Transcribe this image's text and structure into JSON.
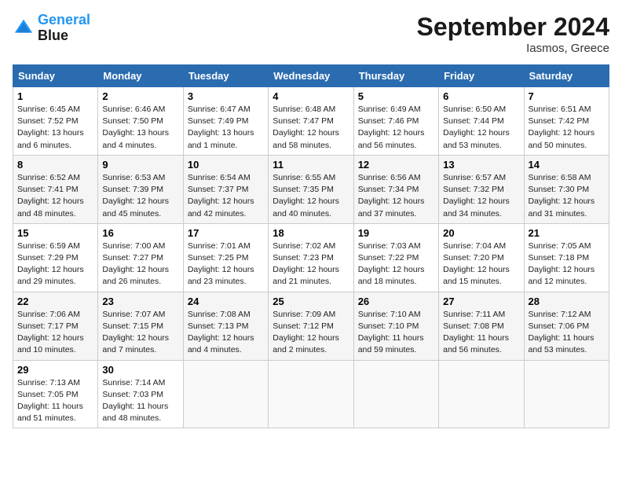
{
  "header": {
    "logo_line1": "General",
    "logo_line2": "Blue",
    "month": "September 2024",
    "location": "Iasmos, Greece"
  },
  "days_of_week": [
    "Sunday",
    "Monday",
    "Tuesday",
    "Wednesday",
    "Thursday",
    "Friday",
    "Saturday"
  ],
  "weeks": [
    [
      {
        "day": "1",
        "sunrise": "6:45 AM",
        "sunset": "7:52 PM",
        "daylight": "13 hours and 6 minutes."
      },
      {
        "day": "2",
        "sunrise": "6:46 AM",
        "sunset": "7:50 PM",
        "daylight": "13 hours and 4 minutes."
      },
      {
        "day": "3",
        "sunrise": "6:47 AM",
        "sunset": "7:49 PM",
        "daylight": "13 hours and 1 minute."
      },
      {
        "day": "4",
        "sunrise": "6:48 AM",
        "sunset": "7:47 PM",
        "daylight": "12 hours and 58 minutes."
      },
      {
        "day": "5",
        "sunrise": "6:49 AM",
        "sunset": "7:46 PM",
        "daylight": "12 hours and 56 minutes."
      },
      {
        "day": "6",
        "sunrise": "6:50 AM",
        "sunset": "7:44 PM",
        "daylight": "12 hours and 53 minutes."
      },
      {
        "day": "7",
        "sunrise": "6:51 AM",
        "sunset": "7:42 PM",
        "daylight": "12 hours and 50 minutes."
      }
    ],
    [
      {
        "day": "8",
        "sunrise": "6:52 AM",
        "sunset": "7:41 PM",
        "daylight": "12 hours and 48 minutes."
      },
      {
        "day": "9",
        "sunrise": "6:53 AM",
        "sunset": "7:39 PM",
        "daylight": "12 hours and 45 minutes."
      },
      {
        "day": "10",
        "sunrise": "6:54 AM",
        "sunset": "7:37 PM",
        "daylight": "12 hours and 42 minutes."
      },
      {
        "day": "11",
        "sunrise": "6:55 AM",
        "sunset": "7:35 PM",
        "daylight": "12 hours and 40 minutes."
      },
      {
        "day": "12",
        "sunrise": "6:56 AM",
        "sunset": "7:34 PM",
        "daylight": "12 hours and 37 minutes."
      },
      {
        "day": "13",
        "sunrise": "6:57 AM",
        "sunset": "7:32 PM",
        "daylight": "12 hours and 34 minutes."
      },
      {
        "day": "14",
        "sunrise": "6:58 AM",
        "sunset": "7:30 PM",
        "daylight": "12 hours and 31 minutes."
      }
    ],
    [
      {
        "day": "15",
        "sunrise": "6:59 AM",
        "sunset": "7:29 PM",
        "daylight": "12 hours and 29 minutes."
      },
      {
        "day": "16",
        "sunrise": "7:00 AM",
        "sunset": "7:27 PM",
        "daylight": "12 hours and 26 minutes."
      },
      {
        "day": "17",
        "sunrise": "7:01 AM",
        "sunset": "7:25 PM",
        "daylight": "12 hours and 23 minutes."
      },
      {
        "day": "18",
        "sunrise": "7:02 AM",
        "sunset": "7:23 PM",
        "daylight": "12 hours and 21 minutes."
      },
      {
        "day": "19",
        "sunrise": "7:03 AM",
        "sunset": "7:22 PM",
        "daylight": "12 hours and 18 minutes."
      },
      {
        "day": "20",
        "sunrise": "7:04 AM",
        "sunset": "7:20 PM",
        "daylight": "12 hours and 15 minutes."
      },
      {
        "day": "21",
        "sunrise": "7:05 AM",
        "sunset": "7:18 PM",
        "daylight": "12 hours and 12 minutes."
      }
    ],
    [
      {
        "day": "22",
        "sunrise": "7:06 AM",
        "sunset": "7:17 PM",
        "daylight": "12 hours and 10 minutes."
      },
      {
        "day": "23",
        "sunrise": "7:07 AM",
        "sunset": "7:15 PM",
        "daylight": "12 hours and 7 minutes."
      },
      {
        "day": "24",
        "sunrise": "7:08 AM",
        "sunset": "7:13 PM",
        "daylight": "12 hours and 4 minutes."
      },
      {
        "day": "25",
        "sunrise": "7:09 AM",
        "sunset": "7:12 PM",
        "daylight": "12 hours and 2 minutes."
      },
      {
        "day": "26",
        "sunrise": "7:10 AM",
        "sunset": "7:10 PM",
        "daylight": "11 hours and 59 minutes."
      },
      {
        "day": "27",
        "sunrise": "7:11 AM",
        "sunset": "7:08 PM",
        "daylight": "11 hours and 56 minutes."
      },
      {
        "day": "28",
        "sunrise": "7:12 AM",
        "sunset": "7:06 PM",
        "daylight": "11 hours and 53 minutes."
      }
    ],
    [
      {
        "day": "29",
        "sunrise": "7:13 AM",
        "sunset": "7:05 PM",
        "daylight": "11 hours and 51 minutes."
      },
      {
        "day": "30",
        "sunrise": "7:14 AM",
        "sunset": "7:03 PM",
        "daylight": "11 hours and 48 minutes."
      },
      null,
      null,
      null,
      null,
      null
    ]
  ]
}
